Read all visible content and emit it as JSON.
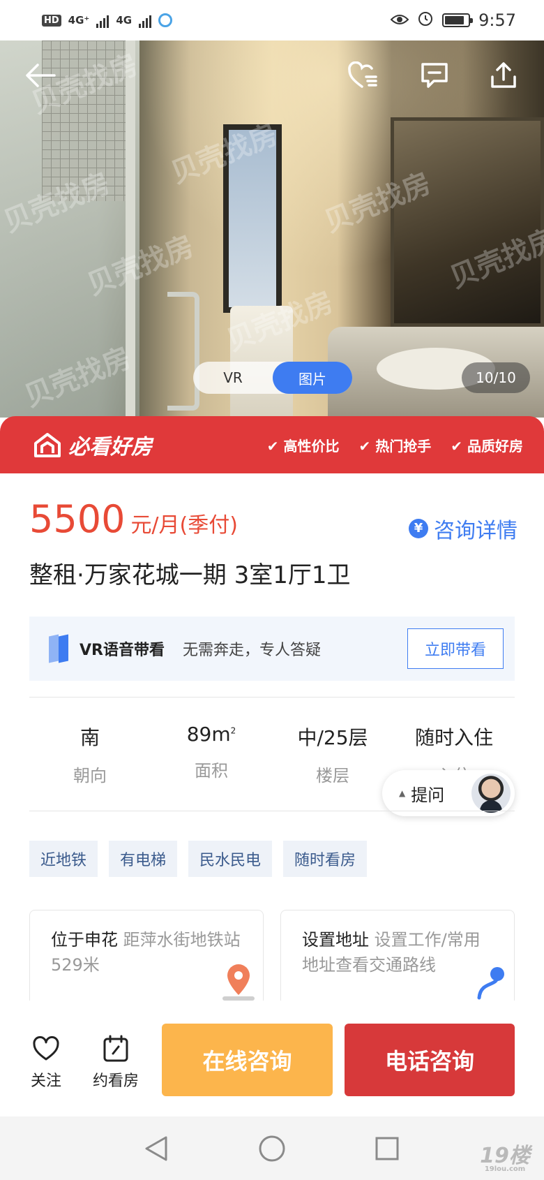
{
  "status_bar": {
    "left_badges": [
      "HD",
      "4G⁺",
      "4G"
    ],
    "time": "9:57",
    "icons": [
      "eye-icon",
      "alarm-icon",
      "battery-icon"
    ]
  },
  "hero": {
    "toggle": {
      "vr_label": "VR",
      "photo_label": "图片",
      "active": "图片"
    },
    "counter": "10/10",
    "watermark_text": "贝壳找房",
    "icons": [
      "back-arrow-icon",
      "heart-list-icon",
      "message-icon",
      "share-icon"
    ]
  },
  "banner": {
    "title": "必看好房",
    "tags": [
      "高性价比",
      "热门抢手",
      "品质好房"
    ]
  },
  "listing": {
    "price": "5500",
    "price_unit": "元/月(季付)",
    "consult_label": "咨询详情",
    "title": "整租·万家花城一期 3室1厅1卫"
  },
  "vr_card": {
    "title": "VR语音带看",
    "desc": "无需奔走，专人答疑",
    "button": "立即带看"
  },
  "facts": [
    {
      "value": "南",
      "label": "朝向"
    },
    {
      "value": "89m",
      "sup": "2",
      "label": "面积"
    },
    {
      "value": "中/25层",
      "label": "楼层"
    },
    {
      "value": "随时入住",
      "label": "入住"
    }
  ],
  "ask_bubble": {
    "label": "提问"
  },
  "tags": [
    "近地铁",
    "有电梯",
    "民水民电",
    "随时看房"
  ],
  "location_cards": [
    {
      "strong": "位于申花",
      "muted": "距萍水街地铁站529米"
    },
    {
      "strong": "设置地址",
      "muted": "设置工作/常用地址查看交通路线"
    }
  ],
  "actions": {
    "follow_label": "关注",
    "schedule_label": "约看房",
    "online_label": "在线咨询",
    "phone_label": "电话咨询"
  },
  "site_watermark": {
    "main": "19楼",
    "sub": "19lou.com"
  },
  "colors": {
    "brand_red": "#e0393a",
    "price_red": "#e84a36",
    "accent_blue": "#3e7cf1",
    "online_orange": "#fcb54c",
    "phone_red": "#d7393a"
  }
}
